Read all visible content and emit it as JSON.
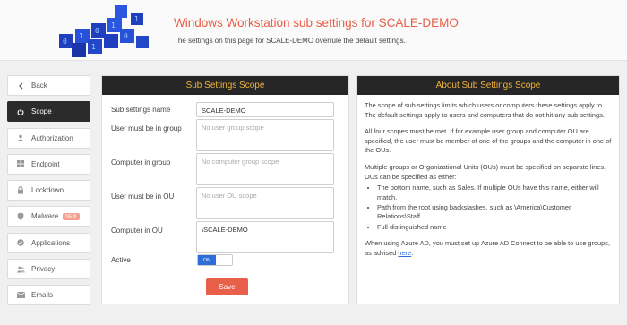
{
  "header": {
    "title": "Windows Workstation sub settings for SCALE-DEMO",
    "subtitle": "The settings on this page for SCALE-DEMO overrule the default settings."
  },
  "sidebar": {
    "items": [
      {
        "label": "Back",
        "icon": "chevron-left-icon"
      },
      {
        "label": "Scope",
        "icon": "power-icon",
        "active": true
      },
      {
        "label": "Authorization",
        "icon": "user-icon"
      },
      {
        "label": "Endpoint",
        "icon": "windows-icon"
      },
      {
        "label": "Lockdown",
        "icon": "lock-icon"
      },
      {
        "label": "Malware",
        "icon": "shield-icon",
        "badge": "NEW"
      },
      {
        "label": "Applications",
        "icon": "check-circle-icon"
      },
      {
        "label": "Privacy",
        "icon": "users-icon"
      },
      {
        "label": "Emails",
        "icon": "envelope-icon"
      }
    ]
  },
  "form": {
    "heading": "Sub Settings Scope",
    "name_label": "Sub settings name",
    "name_value": "SCALE-DEMO",
    "user_group_label": "User must be in group",
    "user_group_placeholder": "No user group scope",
    "computer_group_label": "Computer in group",
    "computer_group_placeholder": "No computer group scope",
    "user_ou_label": "User must be in OU",
    "user_ou_placeholder": "No user OU scope",
    "computer_ou_label": "Computer in OU",
    "computer_ou_value": "\\SCALE-DEMO",
    "active_label": "Active",
    "active_toggle": "ON",
    "save_label": "Save"
  },
  "about": {
    "heading": "About Sub Settings Scope",
    "p1": "The scope of sub settings limits which users or computers these settings apply to. The default settings apply to users and computers that do not hit any sub settings.",
    "p2": "All four scopes must be met. If for example user group and computer OU are specified, the user must be member of one of the groups and the computer in one of the OUs.",
    "p3": "Multiple groups or Organizational Units (OUs) must be specified on separate lines. OUs can be specified as either:",
    "bullets": [
      "The bottom name, such as Sales. If multiple OUs have this name, either will match.",
      "Path from the root using backslashes, such as \\America\\Customer Relations\\Staff",
      "Full distinguished name"
    ],
    "p4": "When using Azure AD, you must set up Azure AD Connect to be able to use groups, as advised",
    "link": "here",
    "p4_end": "."
  },
  "colors": {
    "accent": "#e85d45",
    "panel_header_bg": "#262626",
    "panel_header_text": "#f0b43c",
    "toggle_on": "#2d6fd6",
    "save_button": "#e8604a"
  }
}
